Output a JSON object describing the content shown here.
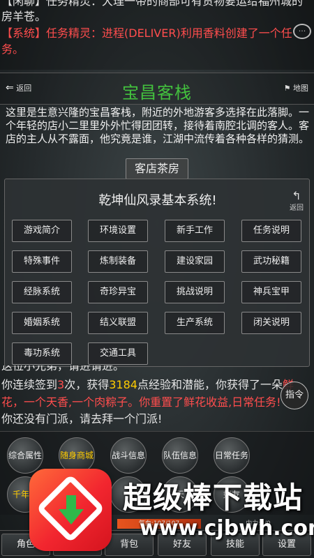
{
  "top_chat": {
    "line1": "【闲聊】任务精灵：大理一带的商部可有货物要运给福州城的",
    "line2": "房羊苍。",
    "line3": "【系统】任务精灵：进程(DELIVER)利用香料创建了一个任",
    "line4": "务。",
    "bubble_icon": "chat-bubble-icon"
  },
  "location": {
    "back_label": "返回",
    "title": "宝昌客栈",
    "map_label": "地图",
    "description": "这里是生意兴隆的宝昌客栈，附近的外地游客多选择在此落脚。一个年轻的店小二里里外外忙得团团转，接待着南腔北调的客人。客店的主人从不露面，他究竟是谁，江湖中流传着各种各样的猜测。",
    "exit_button": "客店茶房"
  },
  "panel": {
    "title": "乾坤仙风录基本系统!",
    "back_label": "返回",
    "buttons": [
      "游戏简介",
      "环境设置",
      "新手工作",
      "任务说明",
      "特殊事件",
      "炼制装备",
      "建设家园",
      "武功秘籍",
      "经脉系统",
      "奇珍异宝",
      "挑战说明",
      "神兵宝甲",
      "婚姻系统",
      "结义联盟",
      "生产系统",
      "闭关说明",
      "毒功系统",
      "交通工具"
    ]
  },
  "bottom_chat": {
    "line0": "这位小兄弟，请进请进。",
    "line1_a": "你连续签到",
    "line1_days": "3",
    "line1_b": "次，获得",
    "line1_exp": "3184",
    "line1_c": "点经验和潜能，你获得了一朵",
    "line1_d": "鲜",
    "line2": "花，一个天香,一个肉粽子。你重置了鲜花收益,日常任务!",
    "line3": "你还没有门派，请去拜一个门派!",
    "command_button": "指令"
  },
  "quick_actions": {
    "row1": [
      "综合属性",
      "随身商城",
      "战斗信息",
      "队伍信息",
      "日常任务"
    ],
    "row2": [
      "千年人",
      "",
      "",
      "天",
      "好友"
    ]
  },
  "status": {
    "hp_label": "气血:107/107",
    "mp_label": "内力:0/0"
  },
  "bottom_nav": [
    "角色",
    "",
    "背包",
    "好友",
    "技能",
    "设置"
  ],
  "watermark": {
    "text": "超级棒下载站",
    "url": "www.cjbwh.com"
  },
  "colors": {
    "location_title": "#43c23e",
    "system_red": "#ff4d4d",
    "highlight_yellow": "#ffcc00",
    "hp_bar": "#e8541e"
  }
}
